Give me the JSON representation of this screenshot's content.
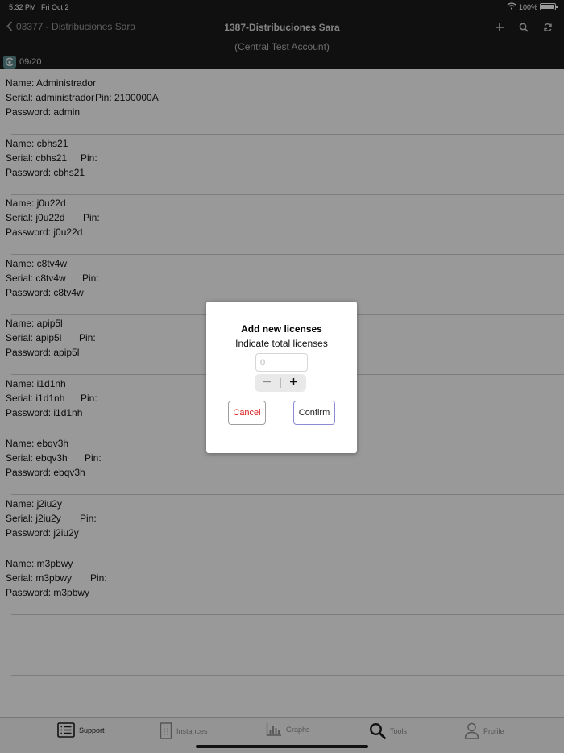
{
  "status_bar": {
    "time": "5:32 PM",
    "date": "Fri Oct 2",
    "battery": "100%"
  },
  "nav": {
    "back_label": "03377 - Distribuciones Sara",
    "title": "1387-Distribuciones Sara",
    "subtitle": "(Central Test Account)",
    "session_count": "09/20",
    "actions": [
      "plus-icon",
      "search-icon",
      "refresh-icon"
    ]
  },
  "records": [
    {
      "name": "Name: Administrador",
      "serial": "Serial: administrador",
      "pin": "Pin: 2100000A",
      "password": "Password: admin"
    },
    {
      "name": "Name: cbhs21",
      "serial": "Serial: cbhs21",
      "pin": "Pin:",
      "password": "Password: cbhs21"
    },
    {
      "name": "Name: j0u22d",
      "serial": "Serial: j0u22d",
      "pin": "Pin:",
      "password": "Password: j0u22d"
    },
    {
      "name": "Name: c8tv4w",
      "serial": "Serial: c8tv4w",
      "pin": "Pin:",
      "password": "Password: c8tv4w"
    },
    {
      "name": "Name: apip5l",
      "serial": "Serial: apip5l",
      "pin": "Pin:",
      "password": "Password: apip5l"
    },
    {
      "name": "Name: i1d1nh",
      "serial": "Serial: i1d1nh",
      "pin": "Pin:",
      "password": "Password: i1d1nh"
    },
    {
      "name": "Name: ebqv3h",
      "serial": "Serial: ebqv3h",
      "pin": "Pin:",
      "password": "Password: ebqv3h"
    },
    {
      "name": "Name: j2iu2y",
      "serial": "Serial: j2iu2y",
      "pin": "Pin:",
      "password": "Password: j2iu2y"
    },
    {
      "name": "Name: m3pbwy",
      "serial": "Serial: m3pbwy",
      "pin": "Pin:",
      "password": "Password: m3pbwy"
    }
  ],
  "dialog": {
    "title": "Add new licenses",
    "subtitle": "Indicate total licenses",
    "input_placeholder": "0",
    "cancel_label": "Cancel",
    "confirm_label": "Confirm"
  },
  "tabs": [
    {
      "label": "Support",
      "icon": "list-icon",
      "active": true
    },
    {
      "label": "Instances",
      "icon": "building-icon",
      "active": false
    },
    {
      "label": "Graphs",
      "icon": "bar-chart-icon",
      "active": false
    },
    {
      "label": "Tools",
      "icon": "search-icon",
      "active": false
    },
    {
      "label": "Profile",
      "icon": "person-icon",
      "active": false
    }
  ],
  "colors": {
    "nav_background": "#1c1c1c",
    "cancel_text": "#d92020",
    "confirm_border": "#8d8ad3"
  }
}
